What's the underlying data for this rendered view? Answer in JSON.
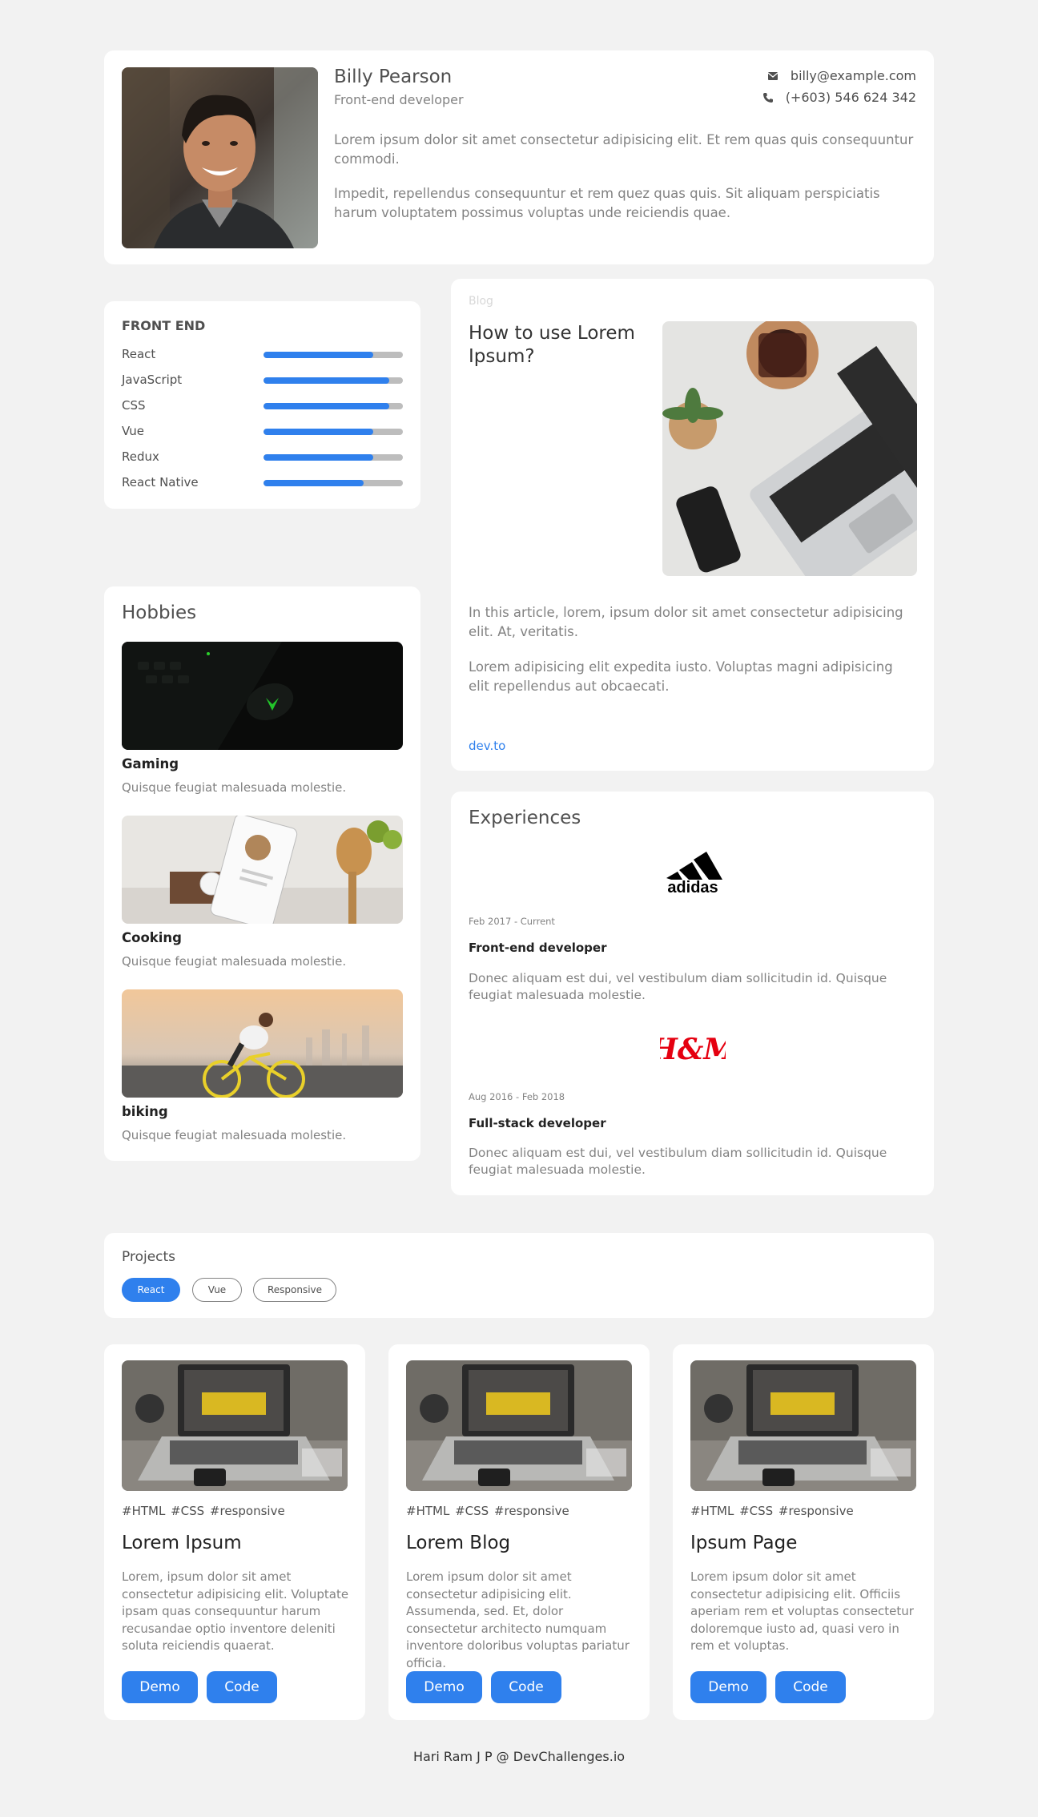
{
  "profile": {
    "name": "Billy Pearson",
    "role": "Front-end developer",
    "email": "billy@example.com",
    "phone": "(+603) 546 624 342",
    "bio1": "Lorem ipsum dolor sit amet consectetur adipisicing elit. Et rem quas quis consequuntur commodi.",
    "bio2": "Impedit, repellendus consequuntur et rem quez quas quis. Sit aliquam perspiciatis harum voluptatem possimus voluptas unde reiciendis quae."
  },
  "skills": {
    "title": "FRONT END",
    "items": [
      {
        "name": "React",
        "level": 0.79
      },
      {
        "name": "JavaScript",
        "level": 0.9
      },
      {
        "name": "CSS",
        "level": 0.9
      },
      {
        "name": "Vue",
        "level": 0.79
      },
      {
        "name": "Redux",
        "level": 0.79
      },
      {
        "name": "React Native",
        "level": 0.72
      }
    ]
  },
  "hobbies": {
    "title": "Hobbies",
    "items": [
      {
        "name": "Gaming",
        "desc": "Quisque feugiat malesuada molestie."
      },
      {
        "name": "Cooking",
        "desc": "Quisque feugiat malesuada molestie."
      },
      {
        "name": "biking",
        "desc": "Quisque feugiat malesuada molestie."
      }
    ]
  },
  "blog": {
    "label": "Blog",
    "title": "How to use Lorem Ipsum?",
    "p1": "In this article, lorem, ipsum dolor sit amet consectetur adipisicing elit. At, veritatis.",
    "p2": "Lorem adipisicing elit expedita iusto. Voluptas magni adipisicing elit repellendus aut obcaecati.",
    "link": "dev.to"
  },
  "experiences": {
    "title": "Experiences",
    "items": [
      {
        "logo_text": "adidas",
        "date": "Feb 2017 - Current",
        "role": "Front-end developer",
        "desc": "Donec aliquam est dui, vel vestibulum diam sollicitudin id. Quisque feugiat malesuada molestie."
      },
      {
        "logo_text": "H&M",
        "date": "Aug 2016 - Feb 2018",
        "role": "Full-stack developer",
        "desc": "Donec aliquam est dui, vel vestibulum diam sollicitudin id. Quisque feugiat malesuada molestie."
      }
    ]
  },
  "projects": {
    "title": "Projects",
    "filters": [
      "React",
      "Vue",
      "Responsive"
    ],
    "active_filter": "React",
    "cards": [
      {
        "tags": "#HTML  #CSS  #responsive",
        "title": "Lorem Ipsum",
        "desc": "Lorem, ipsum dolor sit amet consectetur adipisicing elit. Voluptate ipsam quas consequuntur harum recusandae optio inventore deleniti soluta reiciendis quaerat.",
        "demo": "Demo",
        "code": "Code"
      },
      {
        "tags": "#HTML  #CSS  #responsive",
        "title": "Lorem Blog",
        "desc": "Lorem ipsum dolor sit amet consectetur adipisicing elit. Assumenda, sed. Et, dolor consectetur architecto numquam inventore doloribus voluptas pariatur officia.",
        "demo": "Demo",
        "code": "Code"
      },
      {
        "tags": "#HTML  #CSS  #responsive",
        "title": "Ipsum Page",
        "desc": "Lorem ipsum dolor sit amet consectetur adipisicing elit. Officiis aperiam rem et voluptas consectetur doloremque iusto ad, quasi vero in rem et voluptas.",
        "demo": "Demo",
        "code": "Code"
      }
    ]
  },
  "footer": "Hari Ram J P @ DevChallenges.io",
  "colors": {
    "accent": "#2f80ed",
    "background": "#f2f2f2",
    "muted_text": "#828282",
    "track": "#bdbdbd"
  }
}
